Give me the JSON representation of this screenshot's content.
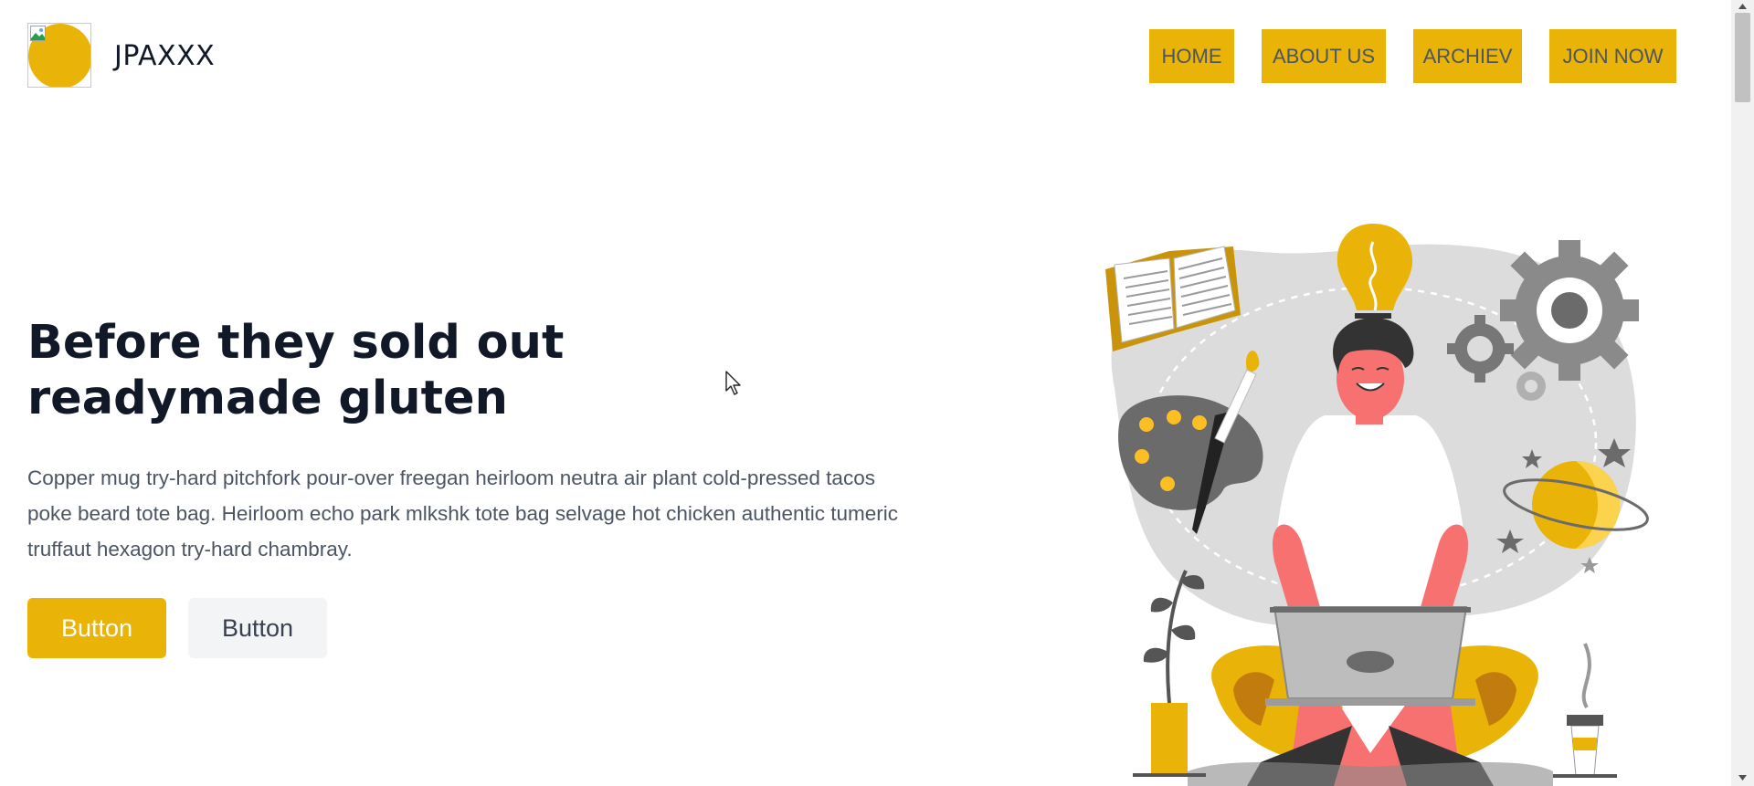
{
  "header": {
    "brand": "JPAXXX",
    "nav": [
      "HOME",
      "ABOUT US",
      "ARCHIEV",
      "JOIN NOW"
    ]
  },
  "hero": {
    "title_line1": "Before they sold out",
    "title_line2": "readymade gluten",
    "description": "Copper mug try-hard pitchfork pour-over freegan heirloom neutra air plant cold-pressed tacos poke beard tote bag. Heirloom echo park mlkshk tote bag selvage hot chicken authentic tumeric truffaut hexagon try-hard chambray.",
    "primary_button": "Button",
    "secondary_button": "Button"
  },
  "colors": {
    "accent": "#eab308",
    "text_dark": "#111827",
    "text_muted": "#4b5563",
    "secondary_bg": "#f3f4f6"
  },
  "icons": [
    "logo-image-icon",
    "broken-image-icon",
    "mouse-cursor-icon",
    "hero-illustration",
    "scroll-up-arrow-icon",
    "scroll-down-arrow-icon"
  ]
}
